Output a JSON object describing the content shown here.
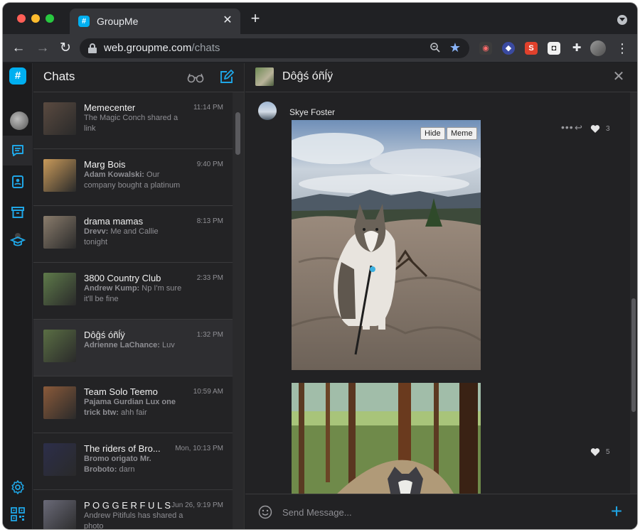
{
  "browser": {
    "tab_title": "GroupMe",
    "tab_close": "✕",
    "new_tab": "+",
    "url_host": "web.groupme.com",
    "url_path": "/chats"
  },
  "rail": {
    "logo": "#"
  },
  "chatlist": {
    "title": "Chats",
    "items": [
      {
        "name": "Memecenter",
        "time": "11:14 PM",
        "author": "",
        "preview": "The Magic Conch shared a link",
        "thumb_color": "#5a4a40"
      },
      {
        "name": "Marg Bois",
        "time": "9:40 PM",
        "author": "Adam Kowalski:",
        "preview": "Our company bought a platinum",
        "thumb_color": "#c99a5a"
      },
      {
        "name": "drama mamas",
        "time": "8:13 PM",
        "author": "Drevv:",
        "preview": "Me and Callie tonight",
        "thumb_color": "#8a7c6c"
      },
      {
        "name": "3800 Country Club",
        "time": "2:33 PM",
        "author": "Andrew Kump:",
        "preview": "Np I'm sure it'll be fine",
        "thumb_color": "#5e7a4a"
      },
      {
        "name": "Dôĝś óñĺÿ",
        "time": "1:32 PM",
        "author": "Adrienne LaChance:",
        "preview": "Luv",
        "thumb_color": "#5a6e44"
      },
      {
        "name": "Team Solo Teemo",
        "time": "10:59 AM",
        "author": "Pajama Gurdian Lux one trick btw:",
        "preview": "ahh fair",
        "thumb_color": "#8a5a3a"
      },
      {
        "name": "The riders of Bro...",
        "time": "Mon, 10:13 PM",
        "author": "Bromo origato Mr. Broboto:",
        "preview": "darn",
        "thumb_color": "#2c2e4a"
      },
      {
        "name": "P O G G E R F U L S",
        "time": "Jun 26, 9:19 PM",
        "author": "",
        "preview": "Andrew Pitifuls has shared a photo",
        "thumb_color": "#6a6a78"
      }
    ]
  },
  "conversation": {
    "title": "Dôĝś óñĺÿ",
    "close": "✕",
    "message": {
      "author": "Skye Foster",
      "hide_label": "Hide",
      "meme_label": "Meme",
      "more_label": "•••",
      "reply_label": "↩",
      "likes_1": "3",
      "likes_2": "5"
    },
    "composer": {
      "placeholder": "Send Message...",
      "attach": "+"
    }
  },
  "colors": {
    "accent": "#00aff0",
    "background": "#202124",
    "panel": "#232325"
  },
  "icons": {
    "rail": [
      "groupme-logo-icon",
      "avatar",
      "chats-icon",
      "contacts-icon",
      "archive-icon",
      "campus-icon",
      "settings-icon",
      "qr-code-icon"
    ],
    "chatlist_header": [
      "glasses-icon",
      "compose-icon"
    ],
    "composer": [
      "emoji-icon",
      "plus-icon"
    ]
  }
}
